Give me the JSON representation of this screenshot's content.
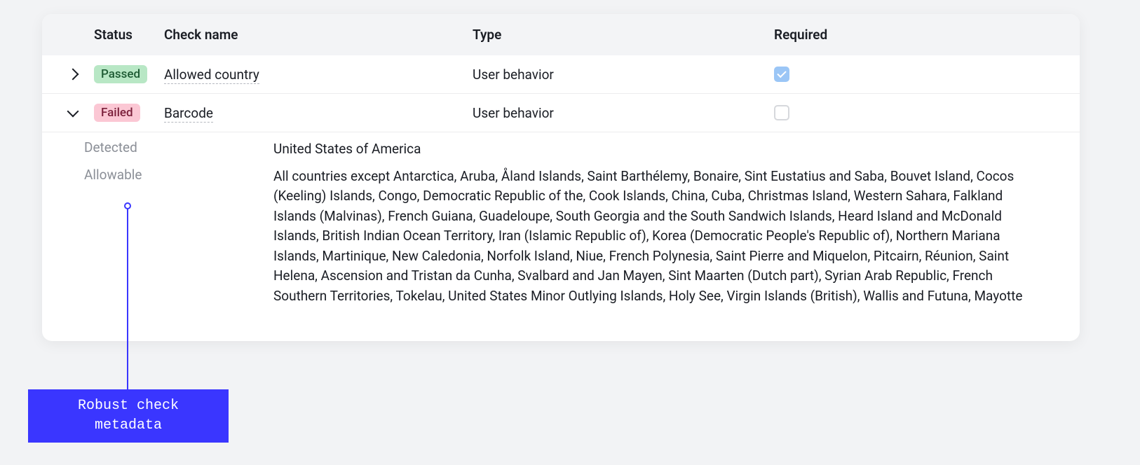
{
  "columns": {
    "status": "Status",
    "check_name": "Check name",
    "type": "Type",
    "required": "Required"
  },
  "rows": [
    {
      "expanded": false,
      "status_label": "Passed",
      "status_kind": "passed",
      "check_name": "Allowed country",
      "type": "User behavior",
      "required": true
    },
    {
      "expanded": true,
      "status_label": "Failed",
      "status_kind": "failed",
      "check_name": "Barcode",
      "type": "User behavior",
      "required": false
    }
  ],
  "details": {
    "detected_label": "Detected",
    "detected_value": "United States of America",
    "allowable_label": "Allowable",
    "allowable_value": "All countries except Antarctica, Aruba, Åland Islands, Saint Barthélemy, Bonaire, Sint Eustatius and Saba, Bouvet Island, Cocos (Keeling) Islands, Congo, Democratic Republic of the, Cook Islands, China, Cuba, Christmas Island, Western Sahara, Falkland Islands (Malvinas), French Guiana, Guadeloupe, South Georgia and the South Sandwich Islands, Heard Island and McDonald Islands, British Indian Ocean Territory, Iran (Islamic Republic of), Korea (Democratic People's Republic of), Northern Mariana Islands, Martinique, New Caledonia, Norfolk Island, Niue, French Polynesia, Saint Pierre and Miquelon, Pitcairn, Réunion, Saint Helena, Ascension and Tristan da Cunha, Svalbard and Jan Mayen, Sint Maarten (Dutch part), Syrian Arab Republic, French Southern Territories, Tokelau, United States Minor Outlying Islands, Holy See, Virgin Islands (British), Wallis and Futuna, Mayotte"
  },
  "annotation": "Robust check\nmetadata"
}
